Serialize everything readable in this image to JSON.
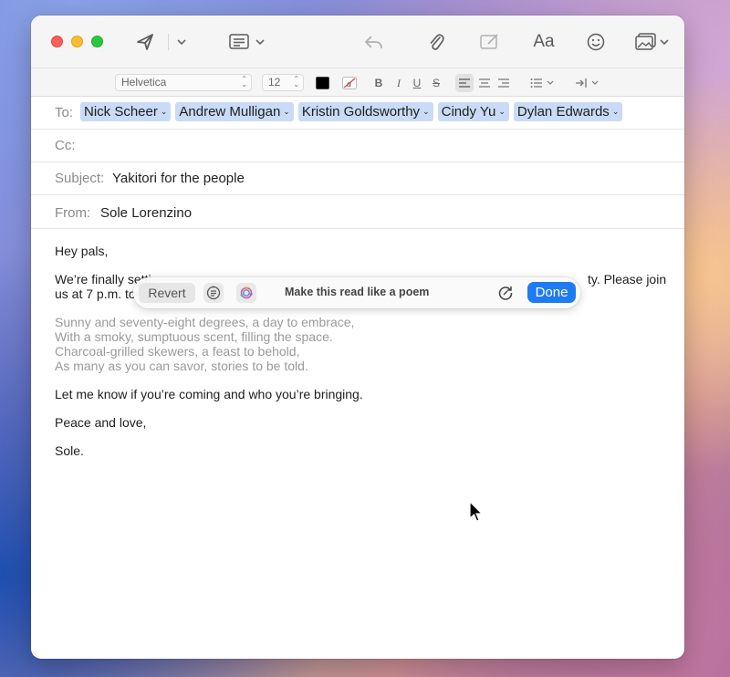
{
  "window": {
    "toolbar": {
      "send_icon": "paper-plane-icon",
      "header_fields_icon": "list-window-icon",
      "reply_icon": "reply-arrow-icon",
      "attach_icon": "paperclip-icon",
      "markup_icon": "markup-icon",
      "format_label": "Aa",
      "emoji_icon": "smiley-icon",
      "photo_icon": "photo-browser-icon"
    },
    "formatbar": {
      "font": "Helvetica",
      "size": "12",
      "text_color": "#000000",
      "bold": "B",
      "italic": "I",
      "underline": "U",
      "strikethrough": "S"
    }
  },
  "headers": {
    "to_label": "To:",
    "recipients": [
      "Nick Scheer",
      "Andrew Mulligan",
      "Kristin Goldsworthy",
      "Cindy Yu",
      "Dylan Edwards"
    ],
    "cc_label": "Cc:",
    "subject_label": "Subject:",
    "subject": "Yakitori for the people",
    "from_label": "From:",
    "from": "Sole Lorenzino"
  },
  "body": {
    "greeting": "Hey pals,",
    "line1_start": "We’re finally setti",
    "line1_end": "ty. Please join",
    "line2_start": "us at 7 p.m. tor",
    "poem": [
      "Sunny and seventy-eight degrees, a day to embrace,",
      "With a smoky, sumptuous scent, filling the space.",
      "Charcoal-grilled skewers, a feast to behold,",
      "As many as you can savor, stories to be told."
    ],
    "rsvp": "Let me know if you’re coming and who you’re bringing.",
    "signoff": "Peace and love,",
    "signature": "Sole."
  },
  "writing_tools": {
    "revert_label": "Revert",
    "summary_icon": "summary-icon",
    "tools_icon": "apple-intelligence-icon",
    "prompt": "Make this read like a poem",
    "rewrite_icon": "rewrite-icon",
    "done_label": "Done"
  },
  "colors": {
    "accent": "#1f7bf2",
    "chip": "#c9dbf6"
  }
}
